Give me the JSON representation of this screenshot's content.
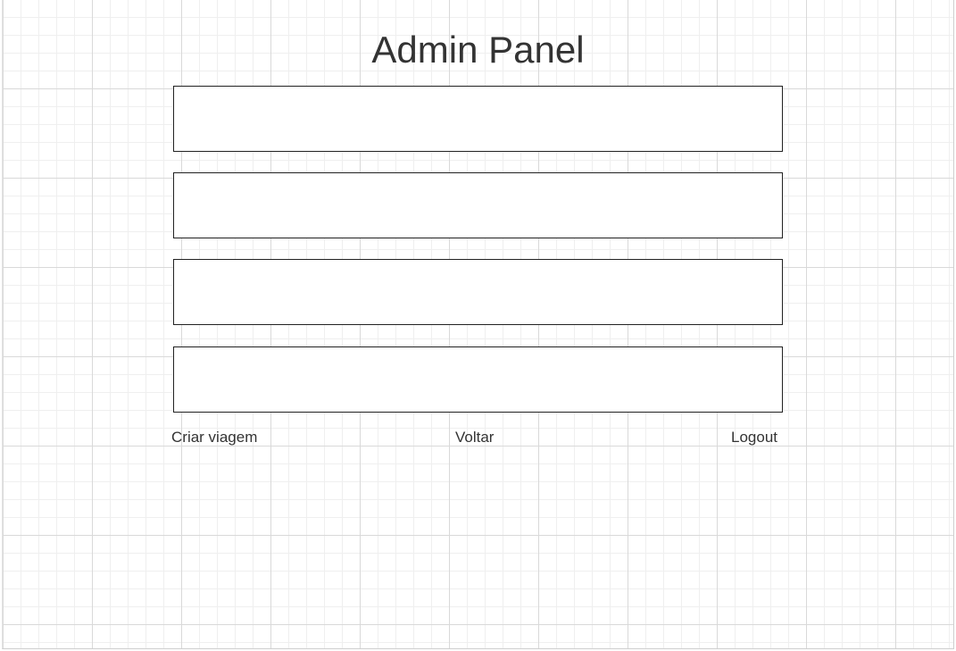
{
  "header": {
    "title": "Admin Panel"
  },
  "panels": [
    {
      "label": ""
    },
    {
      "label": ""
    },
    {
      "label": ""
    },
    {
      "label": ""
    }
  ],
  "actions": {
    "create_trip": "Criar viagem",
    "back": "Voltar",
    "logout": "Logout"
  }
}
